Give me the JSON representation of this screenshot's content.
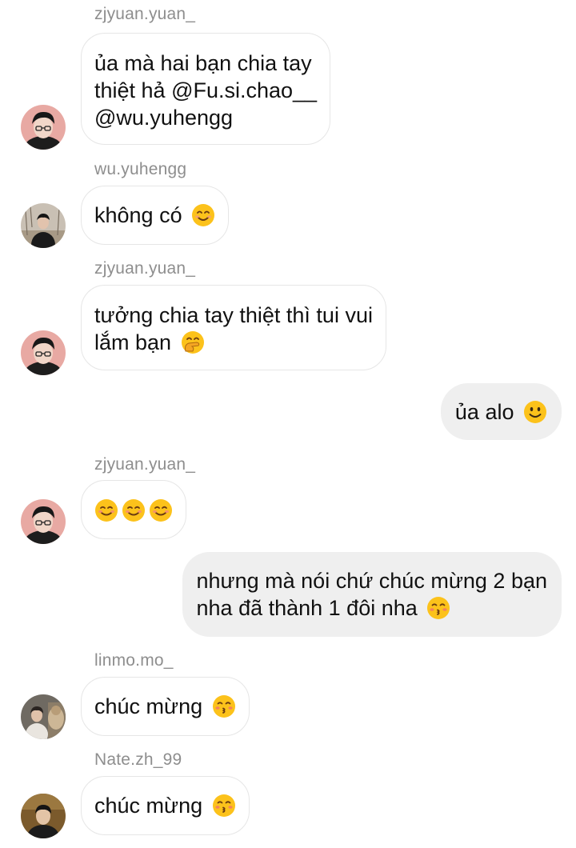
{
  "messages": [
    {
      "sender": "zjyuan.yuan_",
      "lines": [
        "ủa mà hai bạn chia tay",
        "thiệt hả @Fu.si.chao__",
        "@wu.yuhengg"
      ]
    },
    {
      "sender": "wu.yuhengg",
      "lines": [
        "không có"
      ],
      "emoji": "smiling-face-with-smiling-eyes-icon"
    },
    {
      "sender": "zjyuan.yuan_",
      "lines": [
        "tưởng chia tay thiệt thì tui vui",
        "lắm bạn"
      ],
      "emoji": "face-with-hand-over-mouth-icon"
    },
    {
      "outgoing": true,
      "lines": [
        "ủa alo"
      ],
      "emoji": "slightly-smiling-face-icon"
    },
    {
      "sender": "zjyuan.yuan_",
      "emoji_row": [
        "smiling-face-icon",
        "smiling-face-icon",
        "smiling-face-icon"
      ]
    },
    {
      "outgoing": true,
      "lines": [
        "nhưng mà nói chứ chúc mừng 2 bạn",
        "nha đã thành 1 đôi nha"
      ],
      "emoji": "kissing-face-with-closed-eyes-icon"
    },
    {
      "sender": "linmo.mo_",
      "lines": [
        "chúc mừng"
      ],
      "emoji": "kissing-face-with-closed-eyes-icon"
    },
    {
      "sender": "Nate.zh_99",
      "lines": [
        "chúc mừng"
      ],
      "emoji": "kissing-face-with-closed-eyes-icon"
    }
  ],
  "colors": {
    "incoming_bubble": "#ffffff",
    "incoming_border": "#e6e6e6",
    "outgoing_bubble": "#efefef",
    "sender_text": "#8e8e8e",
    "emoji_yellow": "#fcc21b"
  }
}
